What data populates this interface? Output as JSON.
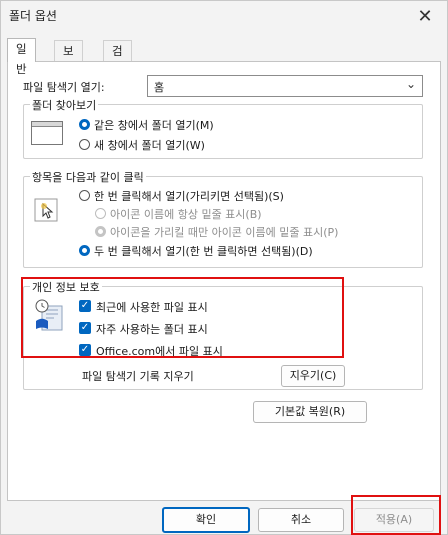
{
  "window": {
    "title": "폴더 옵션",
    "close_symbol": "✕"
  },
  "tabs": [
    {
      "label": "일반",
      "active": true
    },
    {
      "label": "보기",
      "active": false
    },
    {
      "label": "검색",
      "active": false
    }
  ],
  "explorer_open": {
    "label": "파일 탐색기 열기:",
    "value": "홈"
  },
  "browse_folders": {
    "legend": "폴더 찾아보기",
    "option_same": "같은 창에서 폴더 열기(M)",
    "option_new": "새 창에서 폴더 열기(W)",
    "selected": "same"
  },
  "click_items": {
    "legend": "항목을 다음과 같이 클릭",
    "option_single": "한 번 클릭해서 열기(가리키면 선택됨)(S)",
    "sub_always": "아이콘 이름에 항상 밑줄 표시(B)",
    "sub_hover": "아이콘을 가리킬 때만 아이콘 이름에 밑줄 표시(P)",
    "option_double": "두 번 클릭해서 열기(한 번 클릭하면 선택됨)(D)",
    "selected": "double"
  },
  "privacy": {
    "legend": "개인 정보 보호",
    "recent_files": "최근에 사용한 파일 표시",
    "frequent_folders": "자주 사용하는 폴더 표시",
    "office_files": "Office.com에서 파일 표시",
    "clear_label": "파일 탐색기 기록 지우기",
    "clear_button": "지우기(C)"
  },
  "restore_defaults": "기본값 복원(R)",
  "footer": {
    "ok": "확인",
    "cancel": "취소",
    "apply": "적용(A)"
  },
  "colors": {
    "accent": "#0067c0",
    "highlight": "#e01010"
  }
}
